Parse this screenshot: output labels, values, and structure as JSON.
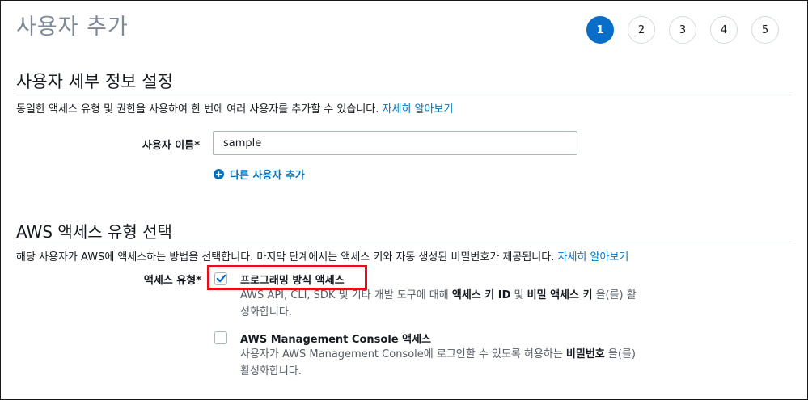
{
  "page": {
    "title": "사용자 추가"
  },
  "steps": [
    "1",
    "2",
    "3",
    "4",
    "5"
  ],
  "user_details": {
    "title": "사용자 세부 정보 설정",
    "description": "동일한 액세스 유형 및 권한을 사용하여 한 번에 여러 사용자를 추가할 수 있습니다.",
    "learn_more": "자세히 알아보기",
    "username_label": "사용자 이름*",
    "username_value": "sample",
    "add_user_label": "다른 사용자 추가"
  },
  "access_type": {
    "title": "AWS 액세스 유형 선택",
    "description": "해당 사용자가 AWS에 액세스하는 방법을 선택합니다. 마지막 단계에서는 액세스 키와 자동 생성된 비밀번호가 제공됩니다.",
    "learn_more": "자세히 알아보기",
    "label": "액세스 유형*",
    "options": [
      {
        "title": "프로그래밍 방식 액세스",
        "checked": true,
        "desc_parts": [
          "AWS API, CLI, SDK 및 기타 개발 도구에 대해 ",
          "액세스 키 ID",
          " 및 ",
          "비밀 액세스 키",
          " 을(를) 활",
          "성화합니다."
        ]
      },
      {
        "title": "AWS Management Console 액세스",
        "checked": false,
        "desc_parts": [
          "사용자가 AWS Management Console에 로그인할 수 있도록 허용하는 ",
          "비밀번호",
          " 을(를)",
          "활성화합니다."
        ]
      }
    ]
  },
  "colors": {
    "accent": "#0a6ec9",
    "link": "#0073bb",
    "highlight": "#e3101b",
    "title_gray": "#7d8998"
  }
}
